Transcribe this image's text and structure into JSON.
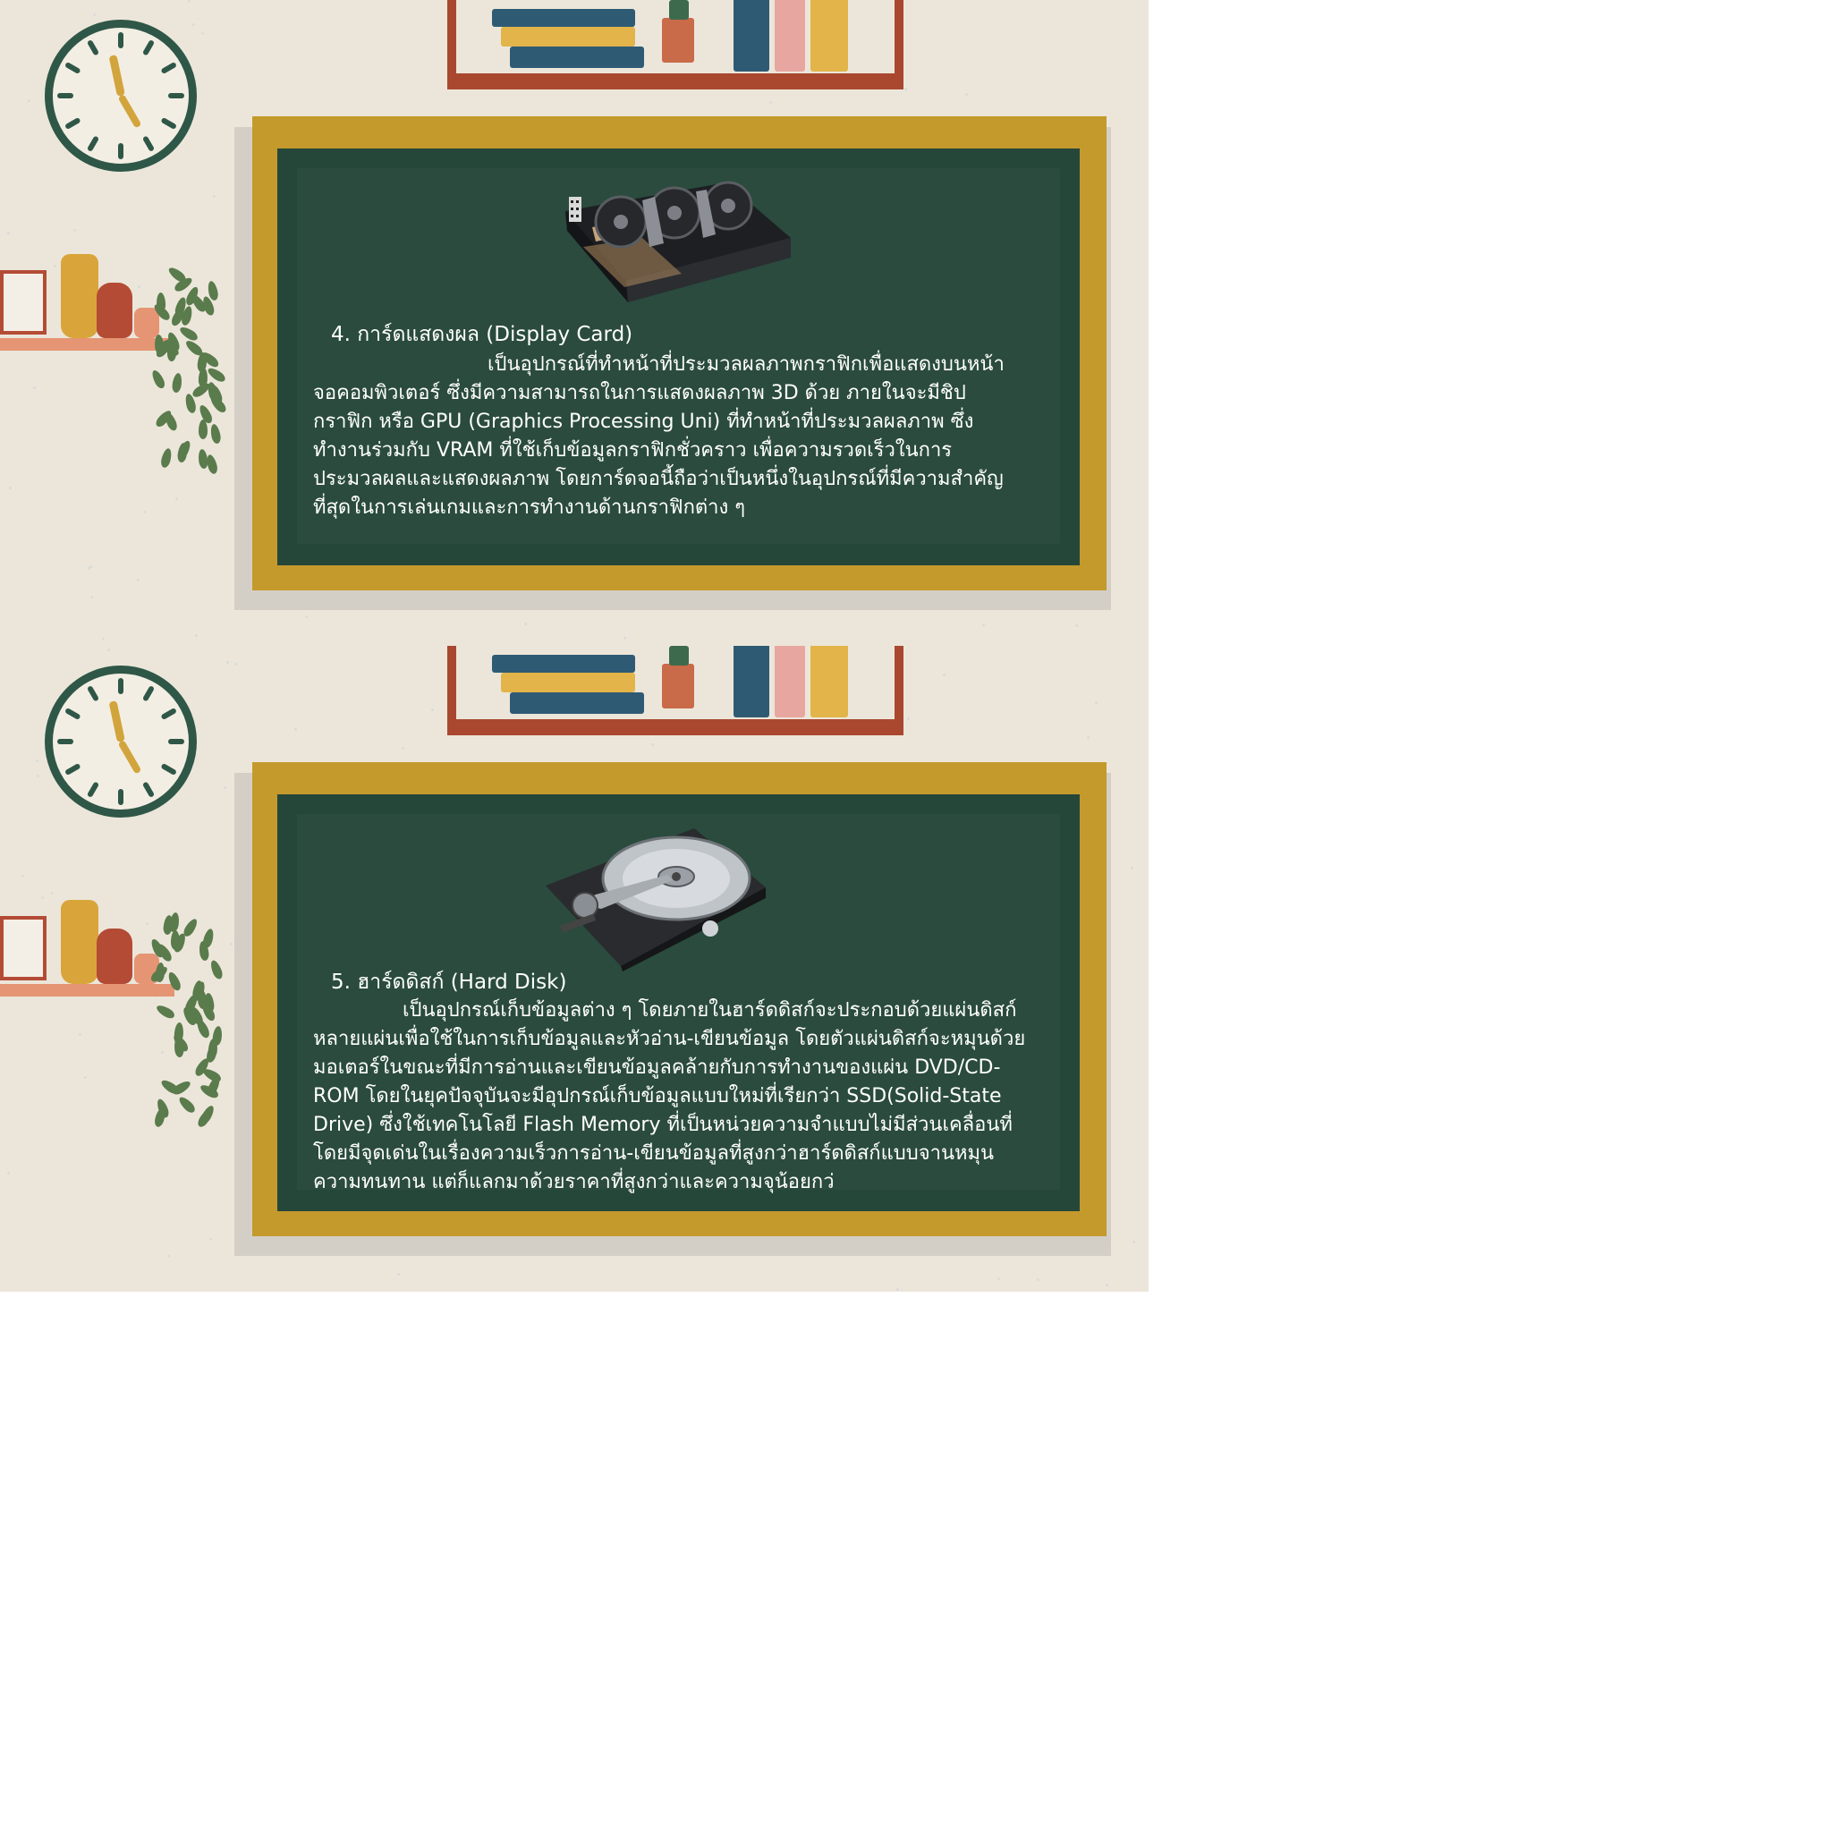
{
  "slides": [
    {
      "title": "4. การ์ดแสดงผล (Display Card)",
      "body": "เป็นอุปกรณ์ที่ทำหน้าที่ประมวลผลภาพกราฟิกเพื่อแสดงบนหน้าจอคอมพิวเตอร์ ซึ่งมีความสามารถในการแสดงผลภาพ 3D ด้วย ภายในจะมีชิปกราฟิก หรือ GPU (Graphics Processing Uni) ที่ทำหน้าที่ประมวลผลภาพ ซึ่งทำงานร่วมกับ VRAM ที่ใช้เก็บข้อมูลกราฟิกชั่วคราว เพื่อความรวดเร็วในการประมวลผลและแสดงผลภาพ โดยการ์ดจอนี้ถือว่าเป็นหนึ่งในอุปกรณ์ที่มีความสำคัญที่สุดในการเล่นเกมและการทำงานด้านกราฟิกต่าง ๆ",
      "image_icon": "graphics-card"
    },
    {
      "title": "5. ฮาร์ดดิสก์ (Hard Disk)",
      "body": "เป็นอุปกรณ์เก็บข้อมูลต่าง ๆ โดยภายในฮาร์ดดิสก์จะประกอบด้วยแผ่นดิสก์หลายแผ่นเพื่อใช้ในการเก็บข้อมูลและหัวอ่าน-เขียนข้อมูล โดยตัวแผ่นดิสก์จะหมุนด้วยมอเตอร์ในขณะที่มีการอ่านและเขียนข้อมูลคล้ายกับการทำงานของแผ่น DVD/CD-ROM โดยในยุคปัจจุบันจะมีอุปกรณ์เก็บข้อมูลแบบใหม่ที่เรียกว่า SSD(Solid-State Drive) ซึ่งใช้เทคโนโลยี Flash Memory ที่เป็นหน่วยความจำแบบไม่มีส่วนเคลื่อนที่ โดยมีจุดเด่นในเรื่องความเร็วการอ่าน-เขียนข้อมูลที่สูงกว่าฮาร์ดดิสก์แบบจานหมุน ความทนทาน แต่ก็แลกมาด้วยราคาที่สูงกว่าและความจุน้อยกว่",
      "image_icon": "hard-disk-drive"
    }
  ],
  "colors": {
    "wall": "#ece6da",
    "board": "#25473a",
    "board_frame": "#c49a2c",
    "shelf": "#a9482f",
    "clock_rim": "#2f5748",
    "chalk": "#ffffff"
  }
}
